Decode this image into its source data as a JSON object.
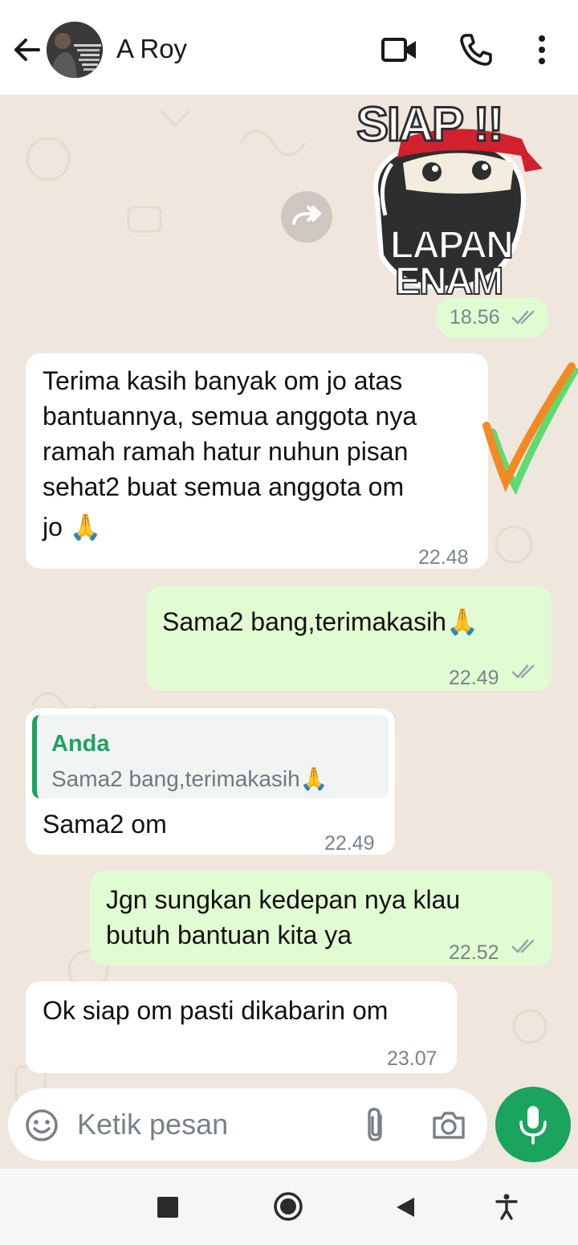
{
  "header": {
    "contact_name": "A Roy",
    "icons": [
      "back-arrow-icon",
      "video-call-icon",
      "voice-call-icon",
      "more-options-icon"
    ]
  },
  "messages": [
    {
      "type": "sticker",
      "direction": "out",
      "time": "18.56",
      "sticker_text": {
        "top": "SIAP !!",
        "middle": "LAPAN",
        "bottom": "ENAM"
      }
    },
    {
      "type": "text",
      "direction": "in",
      "lines": [
        "Terima kasih banyak om jo atas",
        "bantuannya, semua anggota nya",
        "ramah ramah hatur nuhun pisan",
        "sehat2 buat semua anggota om",
        "jo 🙏"
      ],
      "time": "22.48"
    },
    {
      "type": "text",
      "direction": "out",
      "lines": [
        "Sama2 bang,terimakasih🙏"
      ],
      "time": "22.49"
    },
    {
      "type": "reply",
      "direction": "in",
      "quote_author": "Anda",
      "quote_text": "Sama2 bang,terimakasih🙏",
      "text": "Sama2 om",
      "time": "22.49"
    },
    {
      "type": "text",
      "direction": "out",
      "lines": [
        "Jgn sungkan kedepan nya klau",
        "butuh bantuan kita ya"
      ],
      "time": "22.52"
    },
    {
      "type": "text",
      "direction": "in",
      "lines": [
        "Ok siap om pasti dikabarin om"
      ],
      "time": "23.07"
    }
  ],
  "composer": {
    "placeholder": "Ketik pesan",
    "icons": [
      "emoji-icon",
      "attach-icon",
      "camera-icon",
      "mic-icon"
    ]
  },
  "colors": {
    "incoming_bubble": "#ffffff",
    "outgoing_bubble": "#e1fbd3",
    "accent_green": "#1ba45e",
    "read_ticks": "#9aa3a8",
    "chat_background": "#efe7dd"
  },
  "navbar": {
    "icons": [
      "recents-square-icon",
      "home-circle-icon",
      "back-triangle-icon",
      "accessibility-icon"
    ]
  }
}
